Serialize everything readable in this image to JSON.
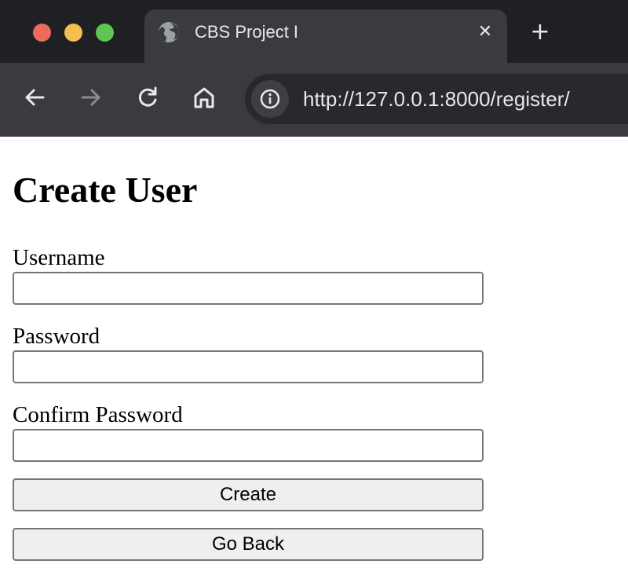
{
  "browser": {
    "tab_title": "CBS Project I",
    "tab_close_glyph": "✕",
    "new_tab_glyph": "+",
    "url": "http://127.0.0.1:8000/register/",
    "icons": {
      "back": "back-arrow-icon",
      "forward": "forward-arrow-icon",
      "reload": "reload-icon",
      "home": "home-icon",
      "site_info": "info-icon",
      "favicon": "globe-icon"
    }
  },
  "form": {
    "title": "Create User",
    "username_label": "Username",
    "password_label": "Password",
    "confirm_label": "Confirm Password",
    "username_value": "",
    "password_value": "",
    "confirm_value": "",
    "create_label": "Create",
    "back_label": "Go Back"
  },
  "colors": {
    "close": "#ed6a5e",
    "minimize": "#f4bf4f",
    "zoom": "#61c554",
    "chrome_bg": "#1f2023",
    "toolbar_bg": "#3a3b3e",
    "button_bg": "#efefef"
  }
}
